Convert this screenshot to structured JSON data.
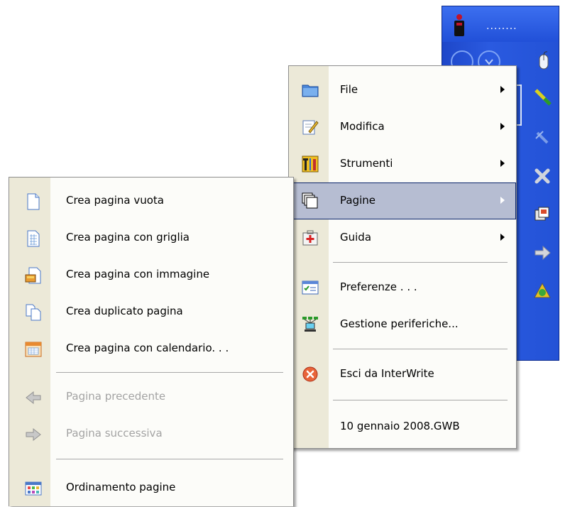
{
  "toolbar": {
    "title_dots": "........"
  },
  "main_menu": {
    "items": [
      {
        "label": "File",
        "icon": "folder-icon",
        "has_submenu": true
      },
      {
        "label": "Modifica",
        "icon": "edit-pencil-icon",
        "has_submenu": true
      },
      {
        "label": "Strumenti",
        "icon": "tools-icon",
        "has_submenu": true
      },
      {
        "label": "Pagine",
        "icon": "pages-icon",
        "has_submenu": true,
        "selected": true
      },
      {
        "label": "Guida",
        "icon": "help-kit-icon",
        "has_submenu": true
      },
      {
        "label": "Preferenze . . .",
        "icon": "preferences-icon"
      },
      {
        "label": "Gestione periferiche...",
        "icon": "devices-icon"
      },
      {
        "label": "Esci da InterWrite",
        "icon": "exit-icon"
      },
      {
        "label": "10 gennaio 2008.GWB",
        "icon": ""
      }
    ]
  },
  "sub_menu": {
    "items": [
      {
        "label": "Crea pagina vuota",
        "icon": "blank-page-icon",
        "enabled": true
      },
      {
        "label": "Crea pagina con griglia",
        "icon": "grid-page-icon",
        "enabled": true
      },
      {
        "label": "Crea pagina con immagine",
        "icon": "image-page-icon",
        "enabled": true
      },
      {
        "label": "Crea duplicato pagina",
        "icon": "duplicate-page-icon",
        "enabled": true
      },
      {
        "label": "Crea pagina con calendario. . .",
        "icon": "calendar-page-icon",
        "enabled": true
      },
      {
        "label": "Pagina precedente",
        "icon": "arrow-left-icon",
        "enabled": false
      },
      {
        "label": "Pagina successiva",
        "icon": "arrow-right-icon",
        "enabled": false
      },
      {
        "label": "Ordinamento pagine",
        "icon": "page-sorter-icon",
        "enabled": true
      }
    ]
  },
  "colors": {
    "menu_background": "#fcfcf9",
    "menu_gutter": "#ece9d8",
    "selected_highlight": "#b6bdd2",
    "selected_border": "#0a246a",
    "disabled_text": "#a3a3a3",
    "toolbar_blue": "#2352d6"
  }
}
